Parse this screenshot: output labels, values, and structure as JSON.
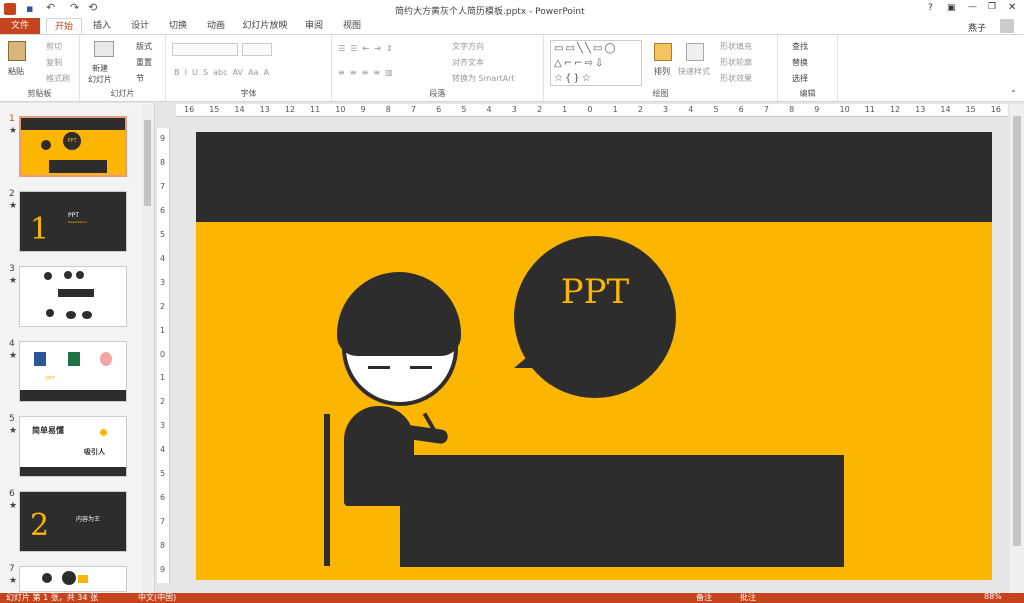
{
  "app": {
    "title": "简约大方黄灰个人简历模板.pptx - PowerPoint",
    "window_controls": [
      "?",
      "—",
      "□",
      "✕"
    ],
    "user": "燕子"
  },
  "tabs": [
    {
      "label": "文件"
    },
    {
      "label": "开始"
    },
    {
      "label": "插入"
    },
    {
      "label": "设计"
    },
    {
      "label": "切换"
    },
    {
      "label": "动画"
    },
    {
      "label": "幻灯片放映"
    },
    {
      "label": "审阅"
    },
    {
      "label": "视图"
    }
  ],
  "ribbon": {
    "clipboard": {
      "label": "剪贴板",
      "paste": "粘贴",
      "cut": "剪切",
      "copy": "复制",
      "format_painter": "格式刷"
    },
    "slides": {
      "label": "幻灯片",
      "new_slide": "新建\n幻灯片",
      "layout": "版式",
      "reset": "重置",
      "section": "节"
    },
    "font": {
      "label": "字体"
    },
    "paragraph": {
      "label": "段落",
      "text_direction": "文字方向",
      "align_text": "对齐文本",
      "smartart": "转换为 SmartArt"
    },
    "drawing": {
      "label": "绘图",
      "arrange": "排列",
      "quick_styles": "快速样式",
      "shape_fill": "形状填充",
      "shape_outline": "形状轮廓",
      "shape_effects": "形状效果"
    },
    "editing": {
      "label": "编辑",
      "find": "查找",
      "replace": "替换",
      "select": "选择"
    }
  },
  "ruler": {
    "h_ticks": [
      "16",
      "15",
      "14",
      "13",
      "12",
      "11",
      "10",
      "9",
      "8",
      "7",
      "6",
      "5",
      "4",
      "3",
      "2",
      "1",
      "0",
      "1",
      "2",
      "3",
      "4",
      "5",
      "6",
      "7",
      "8",
      "9",
      "10",
      "11",
      "12",
      "13",
      "14",
      "15",
      "16"
    ],
    "v_ticks": [
      "9",
      "8",
      "7",
      "6",
      "5",
      "4",
      "3",
      "2",
      "1",
      "0",
      "1",
      "2",
      "3",
      "4",
      "5",
      "6",
      "7",
      "8",
      "9"
    ]
  },
  "thumbnails": [
    {
      "num": "1",
      "star": "★",
      "text": "PPT"
    },
    {
      "num": "2",
      "star": "★",
      "text": "PPT",
      "sub": "Presentation"
    },
    {
      "num": "3",
      "star": "★",
      "text": ""
    },
    {
      "num": "4",
      "star": "★",
      "text": "PPT"
    },
    {
      "num": "5",
      "star": "★",
      "text": "简单易懂",
      "text2": "吸引人"
    },
    {
      "num": "6",
      "star": "★",
      "text": "内容为王"
    },
    {
      "num": "7",
      "star": "★",
      "text": ""
    }
  ],
  "slide": {
    "bubble_text": "PPT",
    "colors": {
      "yellow": "#fdb600",
      "dark": "#2d2d2d"
    }
  },
  "status": {
    "left": "幻灯片 第 1 张，共 34 张",
    "lang": "中文(中国)",
    "notes": "备注",
    "comments": "批注",
    "zoom": "88%"
  }
}
